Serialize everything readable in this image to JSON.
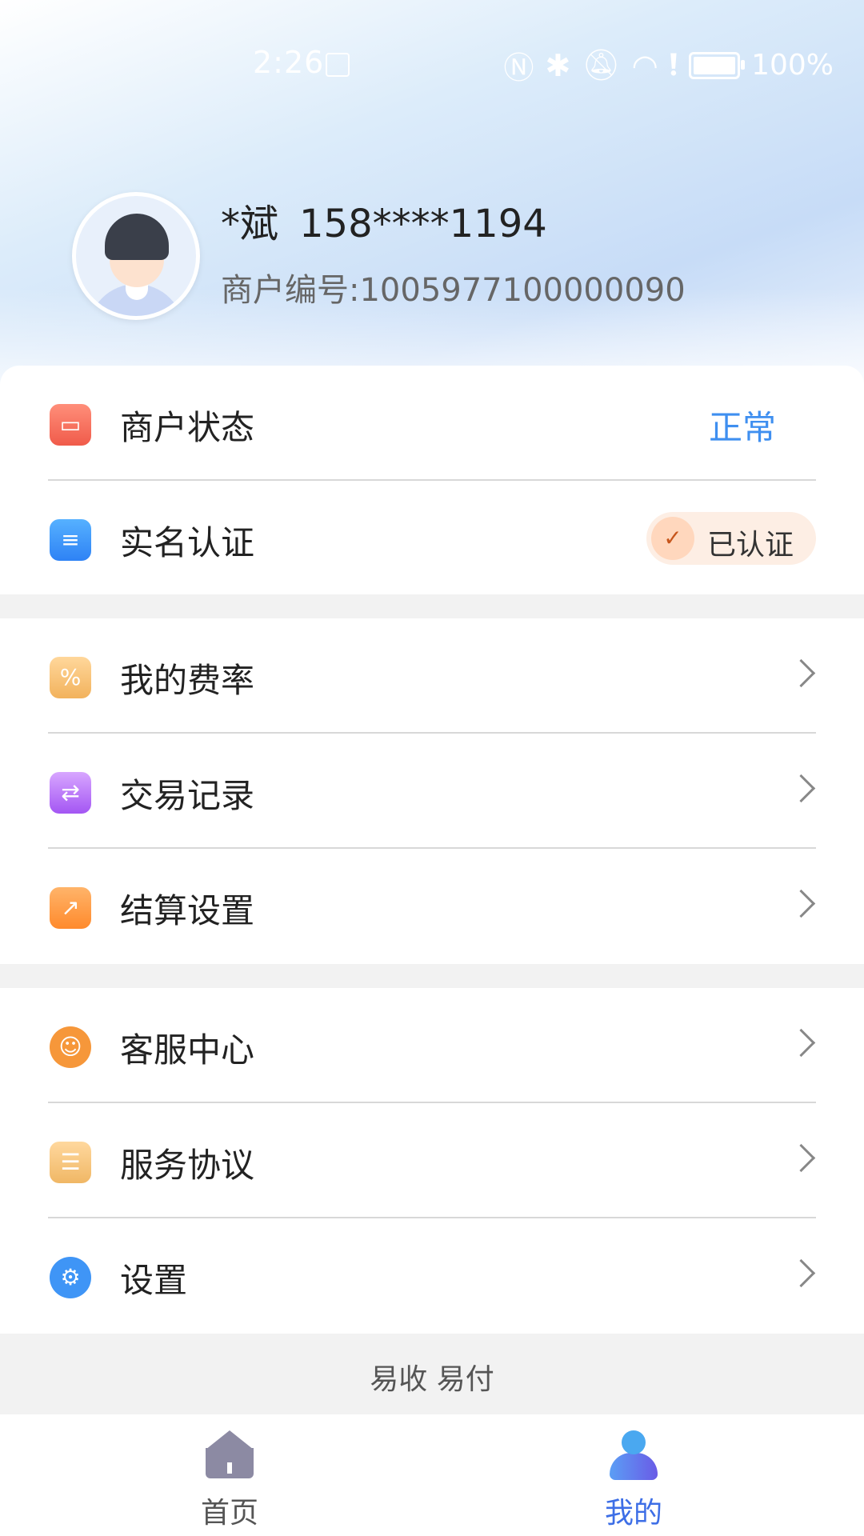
{
  "status_bar": {
    "time": "2:26",
    "battery_pct": "100%",
    "icons": [
      "nfc-icon",
      "bluetooth-icon",
      "mute-icon",
      "wifi-icon",
      "alert-icon",
      "battery-icon"
    ]
  },
  "profile": {
    "name": "*斌",
    "phone": "158****1194",
    "merchant_no": "商户编号:1005977100000090"
  },
  "section1": [
    {
      "label": "商户状态",
      "value": "正常",
      "icon": "store-icon"
    },
    {
      "label": "实名认证",
      "badge": "已认证",
      "icon": "id-card-icon"
    }
  ],
  "section2": [
    {
      "label": "我的费率",
      "icon": "rate-icon"
    },
    {
      "label": "交易记录",
      "icon": "transaction-icon"
    },
    {
      "label": "结算设置",
      "icon": "settlement-icon"
    }
  ],
  "section3": [
    {
      "label": "客服中心",
      "icon": "customer-service-icon"
    },
    {
      "label": "服务协议",
      "icon": "agreement-icon"
    },
    {
      "label": "设置",
      "icon": "settings-gear-icon"
    }
  ],
  "footer_slogan": "易收 易付",
  "tabbar": {
    "home": "首页",
    "mine": "我的"
  },
  "colors": {
    "accent": "#3f8ff0",
    "active_tab": "#3d6ee6"
  }
}
